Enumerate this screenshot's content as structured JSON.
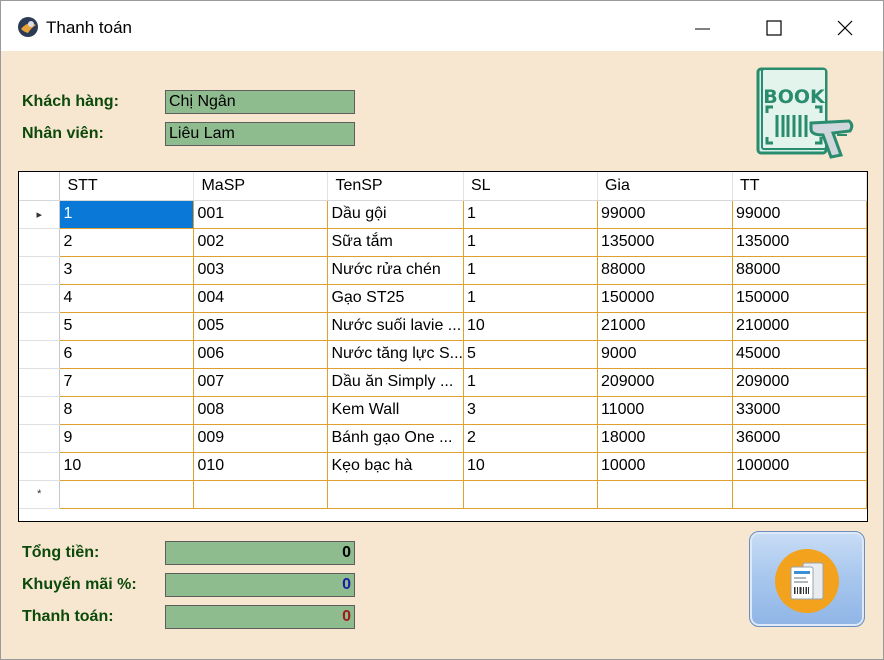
{
  "window": {
    "title": "Thanh toán",
    "icon": "app-globe-icon",
    "controls": [
      "minimize-icon",
      "maximize-icon",
      "close-icon"
    ]
  },
  "customer": {
    "label": "Khách hàng:",
    "value": "Chị Ngân"
  },
  "employee": {
    "label": "Nhân viên:",
    "value": "Liêu Lam"
  },
  "logo": {
    "text": "BOOK",
    "icon": "book-barcode-scanner-icon"
  },
  "table": {
    "columns": [
      "STT",
      "MaSP",
      "TenSP",
      "SL",
      "Gia",
      "TT"
    ],
    "rows": [
      [
        "1",
        "001",
        "Dầu gội",
        "1",
        "99000",
        "99000"
      ],
      [
        "2",
        "002",
        "Sữa tắm",
        "1",
        "135000",
        "135000"
      ],
      [
        "3",
        "003",
        "Nước rửa chén",
        "1",
        "88000",
        "88000"
      ],
      [
        "4",
        "004",
        "Gạo ST25",
        "1",
        "150000",
        "150000"
      ],
      [
        "5",
        "005",
        "Nước suối lavie ...",
        "10",
        "21000",
        "210000"
      ],
      [
        "6",
        "006",
        "Nước tăng lực S...",
        "5",
        "9000",
        "45000"
      ],
      [
        "7",
        "007",
        "Dầu ăn Simply ...",
        "1",
        "209000",
        "209000"
      ],
      [
        "8",
        "008",
        "Kem Wall",
        "3",
        "11000",
        "33000"
      ],
      [
        "9",
        "009",
        "Bánh gạo One ...",
        "2",
        "18000",
        "36000"
      ],
      [
        "10",
        "010",
        "Kẹo bạc hà",
        "10",
        "10000",
        "100000"
      ]
    ],
    "current_row_marker": "▸",
    "new_row_marker": "*"
  },
  "totals": {
    "total": {
      "label": "Tổng tiền:",
      "value": "0",
      "color": "#000000"
    },
    "discount": {
      "label": "Khuyến mãi %:",
      "value": "0",
      "color": "#1a1aa6"
    },
    "payment": {
      "label": "Thanh toán:",
      "value": "0",
      "color": "#a01a1a"
    }
  },
  "pay_button": {
    "icon": "receipt-icon"
  },
  "colors": {
    "background": "#f8e7d0",
    "field": "#8fbc8f",
    "label": "#0b4a0b",
    "selection": "#0a78d7",
    "grid_line": "#e0a030"
  }
}
